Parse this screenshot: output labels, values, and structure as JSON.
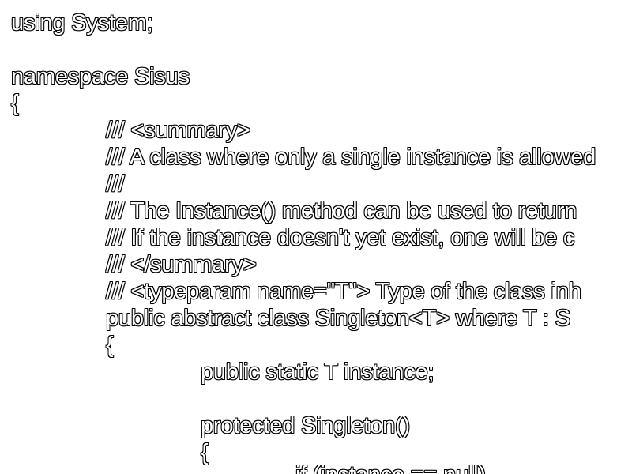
{
  "code": {
    "lines": [
      "using System;",
      "",
      "namespace Sisus",
      "{",
      "/// <summary>",
      "/// A class where only a single instance is allowed",
      "///",
      "/// The Instance() method can be used to return",
      "/// If the instance doesn't yet exist, one will be c",
      "/// </summary>",
      "/// <typeparam name=\"T\"> Type of the class inh",
      "public abstract class Singleton<T> where T : S",
      "{",
      "public static T instance;",
      "",
      "protected Singleton()",
      "{",
      "if (instance == null)"
    ]
  }
}
